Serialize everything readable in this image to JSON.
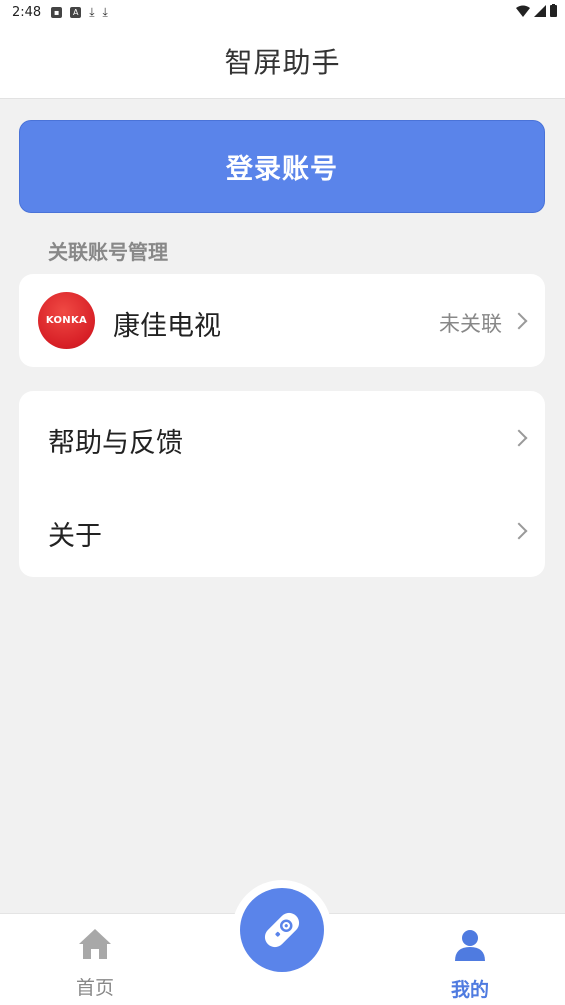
{
  "status_bar": {
    "time": "2:48"
  },
  "header": {
    "title": "智屏助手"
  },
  "login_button": {
    "label": "登录账号"
  },
  "linked_accounts": {
    "section_label": "关联账号管理",
    "items": [
      {
        "logo_text": "KONKA",
        "name": "康佳电视",
        "status": "未关联"
      }
    ]
  },
  "menu": {
    "items": [
      {
        "label": "帮助与反馈"
      },
      {
        "label": "关于"
      }
    ]
  },
  "bottom_nav": {
    "items": [
      {
        "label": "首页",
        "icon": "home-icon",
        "active": false
      },
      {
        "label": "",
        "icon": "remote-control-icon",
        "active": false
      },
      {
        "label": "我的",
        "icon": "user-icon",
        "active": true
      }
    ]
  },
  "colors": {
    "accent": "#5a84ea",
    "active_tab": "#4f7be0",
    "brand_red": "#d71f26"
  }
}
